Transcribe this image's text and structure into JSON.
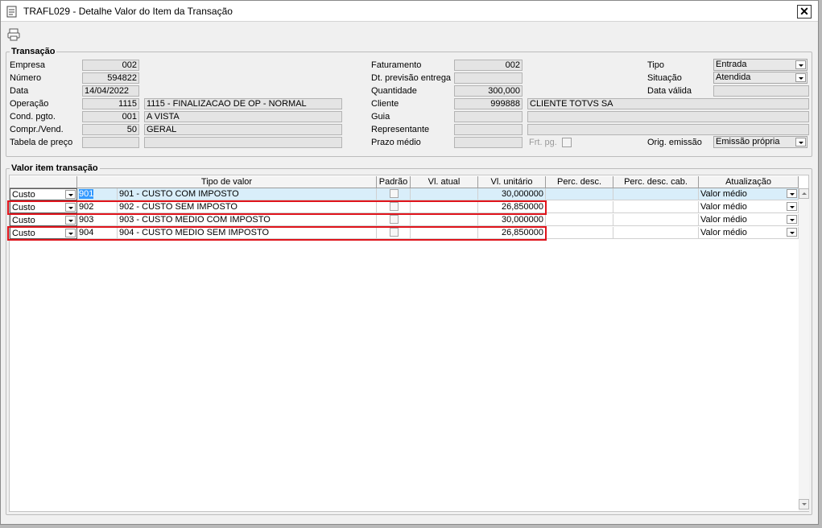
{
  "window": {
    "title": "TRAFL029 - Detalhe Valor do Item da Transação",
    "close_label": "✕"
  },
  "toolbar": {
    "print_icon": "printer-icon"
  },
  "transacao": {
    "legend": "Transação",
    "empresa": {
      "label": "Empresa",
      "value": "002"
    },
    "numero": {
      "label": "Número",
      "value": "594822"
    },
    "data": {
      "label": "Data",
      "value": "14/04/2022"
    },
    "operacao": {
      "label": "Operação",
      "code": "1115",
      "desc": "1115 - FINALIZACAO DE OP - NORMAL"
    },
    "cond_pgto": {
      "label": "Cond. pgto.",
      "code": "001",
      "desc": "A VISTA"
    },
    "compr_vend": {
      "label": "Compr./Vend.",
      "code": "50",
      "desc": "GERAL"
    },
    "tabela_preco": {
      "label": "Tabela de preço",
      "code": "",
      "desc": ""
    },
    "faturamento": {
      "label": "Faturamento",
      "value": "002"
    },
    "dt_previsao": {
      "label": "Dt. previsão entrega",
      "value": ""
    },
    "quantidade": {
      "label": "Quantidade",
      "value": "300,000"
    },
    "cliente": {
      "label": "Cliente",
      "code": "999888",
      "desc": "CLIENTE TOTVS SA"
    },
    "guia": {
      "label": "Guia",
      "code": "",
      "desc": ""
    },
    "representante": {
      "label": "Representante",
      "code": "",
      "desc": ""
    },
    "prazo_medio": {
      "label": "Prazo médio",
      "value": ""
    },
    "frt_pg": {
      "label": "Frt. pg."
    },
    "tipo": {
      "label": "Tipo",
      "value": "Entrada"
    },
    "situacao": {
      "label": "Situação",
      "value": "Atendida"
    },
    "data_valida": {
      "label": "Data válida",
      "value": ""
    },
    "orig_emissao": {
      "label": "Orig. emissão",
      "value": "Emissão própria"
    }
  },
  "valor_item": {
    "legend": "Valor item transação",
    "columns": {
      "tipo_valor": "Tipo de valor",
      "padrao": "Padrão",
      "vl_atual": "Vl. atual",
      "vl_unitario": "Vl. unitário",
      "perc_desc": "Perc. desc.",
      "perc_desc_cab": "Perc. desc. cab.",
      "atualizacao": "Atualização"
    },
    "rows": [
      {
        "tipo": "Custo",
        "code": "901",
        "desc": "901 - CUSTO COM IMPOSTO",
        "vl_atual": "",
        "vl_unitario": "30,000000",
        "perc_desc": "",
        "perc_desc_cab": "",
        "atualizacao": "Valor médio"
      },
      {
        "tipo": "Custo",
        "code": "902",
        "desc": "902 - CUSTO SEM IMPOSTO",
        "vl_atual": "",
        "vl_unitario": "26,850000",
        "perc_desc": "",
        "perc_desc_cab": "",
        "atualizacao": "Valor médio"
      },
      {
        "tipo": "Custo",
        "code": "903",
        "desc": "903 - CUSTO MEDIO COM IMPOSTO",
        "vl_atual": "",
        "vl_unitario": "30,000000",
        "perc_desc": "",
        "perc_desc_cab": "",
        "atualizacao": "Valor médio"
      },
      {
        "tipo": "Custo",
        "code": "904",
        "desc": "904 - CUSTO MEDIO SEM IMPOSTO",
        "vl_atual": "",
        "vl_unitario": "26,850000",
        "perc_desc": "",
        "perc_desc_cab": "",
        "atualizacao": "Valor médio"
      }
    ]
  },
  "colors": {
    "highlight": "#e0141c",
    "selection": "#3399ff",
    "row_highlight": "#d9eefa"
  }
}
